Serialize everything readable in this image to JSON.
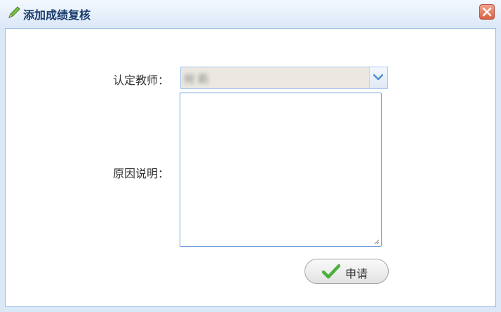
{
  "dialog": {
    "title": "添加成绩复核",
    "title_icon": "pencil-icon",
    "close_icon": "close-icon"
  },
  "form": {
    "teacher_label": "认定教师：",
    "teacher_value": "何 莉",
    "reason_label": "原因说明：",
    "reason_value": ""
  },
  "actions": {
    "apply_label": "申请",
    "apply_icon": "checkmark-icon"
  },
  "colors": {
    "title_text": "#1a3d6e",
    "panel_border": "#9bbbe6",
    "close_button": "#d8603f",
    "checkmark": "#4caf3a"
  }
}
